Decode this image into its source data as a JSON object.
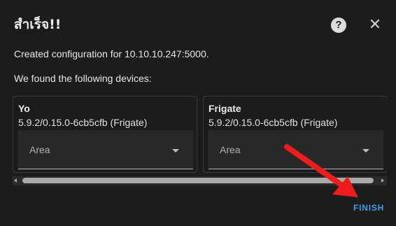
{
  "dialog": {
    "title": "สำเร็จ!!",
    "help_icon": "help-circle-icon",
    "help_glyph": "?",
    "close_icon": "close-icon",
    "close_glyph": "✕",
    "created_message": "Created configuration for 10.10.10.247:5000.",
    "devices_heading": "We found the following devices:"
  },
  "devices": [
    {
      "name": "Yo",
      "version": "5.9.2/0.15.0-6cb5cfb (Frigate)",
      "area_label": "Area"
    },
    {
      "name": "Frigate",
      "version": "5.9.2/0.15.0-6cb5cfb (Frigate)",
      "area_label": "Area"
    }
  ],
  "actions": {
    "finish_label": "FINISH"
  },
  "annotation": {
    "arrow_color": "#ee1c1c"
  },
  "colors": {
    "accent": "#3f9fe8",
    "background": "#1c1c1c"
  }
}
